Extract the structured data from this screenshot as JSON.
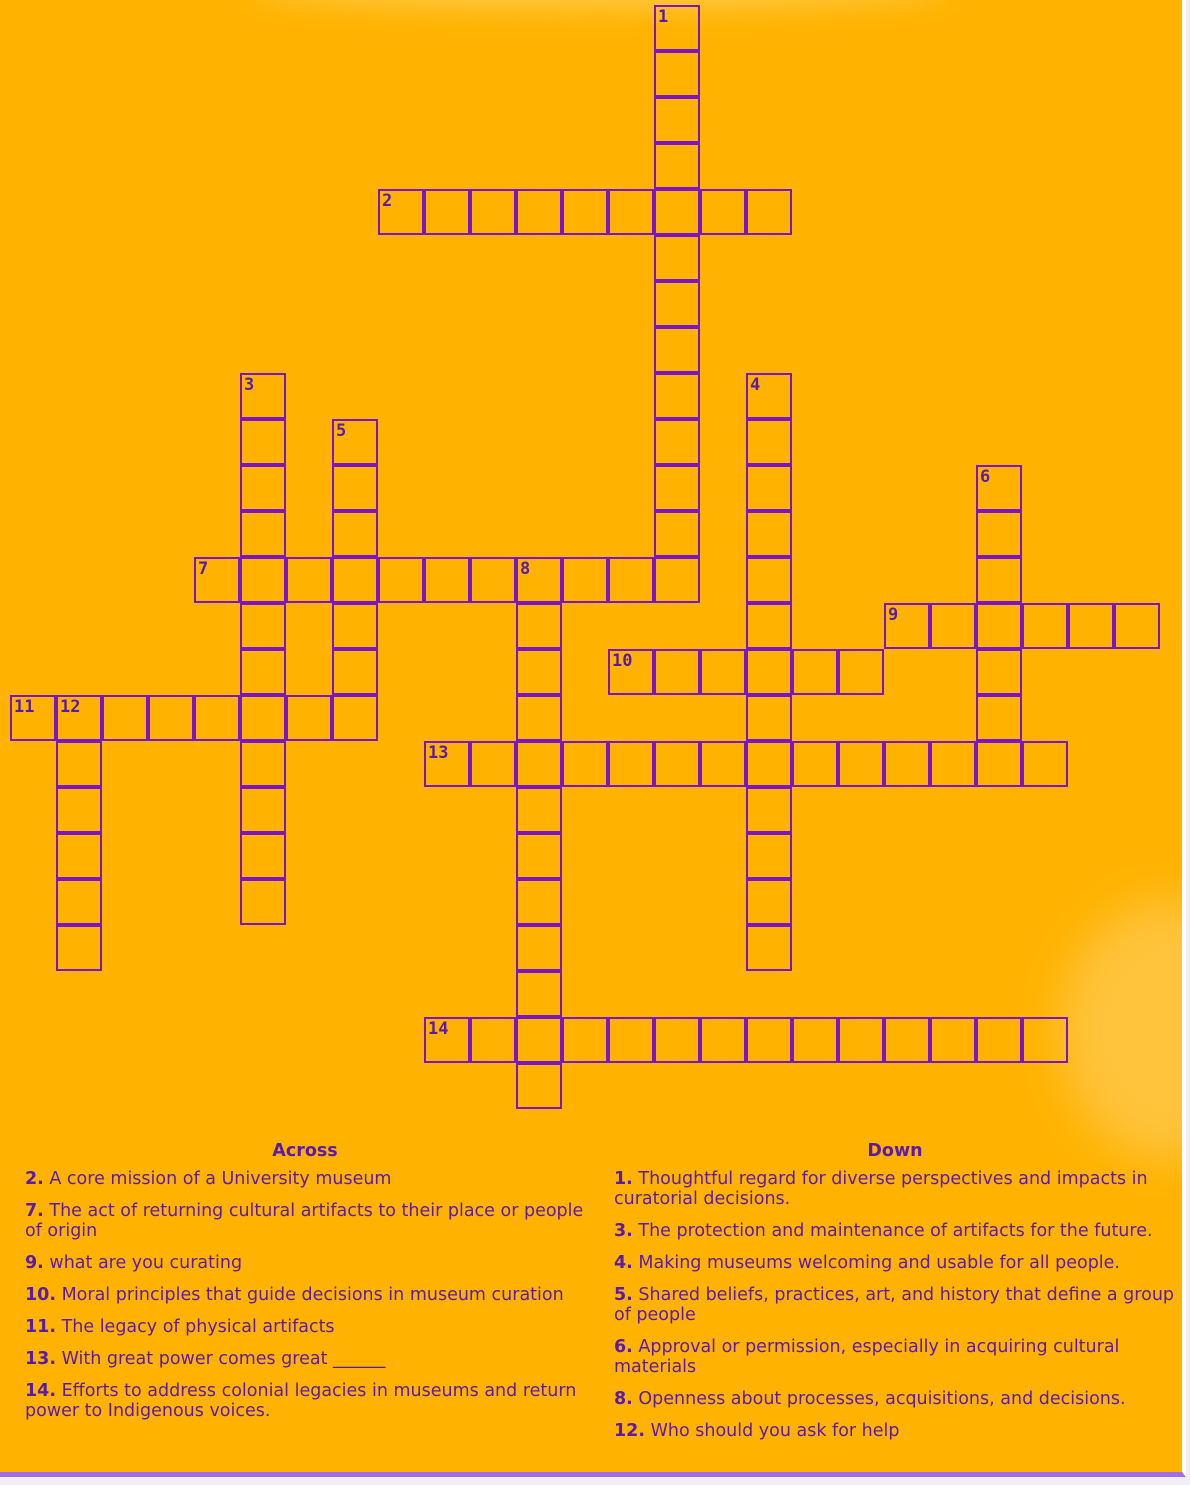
{
  "colors": {
    "background": "#ffb300",
    "grid_line": "#7a16c8",
    "text": "#5b1aa8"
  },
  "across_heading": "Across",
  "down_heading": "Down",
  "across": [
    {
      "num": "2",
      "text": "A core mission of a University museum",
      "row": 4,
      "col": 8,
      "length": 9
    },
    {
      "num": "7",
      "text": "The act of returning cultural artifacts to their place or people of origin",
      "row": 12,
      "col": 4,
      "length": 11
    },
    {
      "num": "9",
      "text": "what are you curating",
      "row": 13,
      "col": 19,
      "length": 6
    },
    {
      "num": "10",
      "text": "Moral principles that guide decisions in museum curation",
      "row": 14,
      "col": 13,
      "length": 6
    },
    {
      "num": "11",
      "text": "The legacy of physical artifacts",
      "row": 15,
      "col": 0,
      "length": 8
    },
    {
      "num": "13",
      "text": "With great power comes great ______",
      "row": 16,
      "col": 9,
      "length": 14
    },
    {
      "num": "14",
      "text": "Efforts to address colonial legacies in museums and return power to Indigenous voices.",
      "row": 22,
      "col": 9,
      "length": 14
    }
  ],
  "down": [
    {
      "num": "1",
      "text": "Thoughtful regard for diverse perspectives and impacts in curatorial decisions.",
      "row": 0,
      "col": 14,
      "length": 13
    },
    {
      "num": "3",
      "text": "The protection and maintenance of artifacts for the future.",
      "row": 8,
      "col": 5,
      "length": 12
    },
    {
      "num": "4",
      "text": "Making museums welcoming and usable for all people.",
      "row": 8,
      "col": 16,
      "length": 13
    },
    {
      "num": "5",
      "text": "Shared beliefs, practices, art, and history that define a group of people",
      "row": 9,
      "col": 7,
      "length": 7
    },
    {
      "num": "6",
      "text": "Approval or permission, especially in acquiring cultural materials",
      "row": 10,
      "col": 21,
      "length": 7
    },
    {
      "num": "8",
      "text": "Openness about processes, acquisitions, and decisions.",
      "row": 12,
      "col": 11,
      "length": 12
    },
    {
      "num": "12",
      "text": "Who should you ask for help",
      "row": 15,
      "col": 1,
      "length": 6
    }
  ]
}
